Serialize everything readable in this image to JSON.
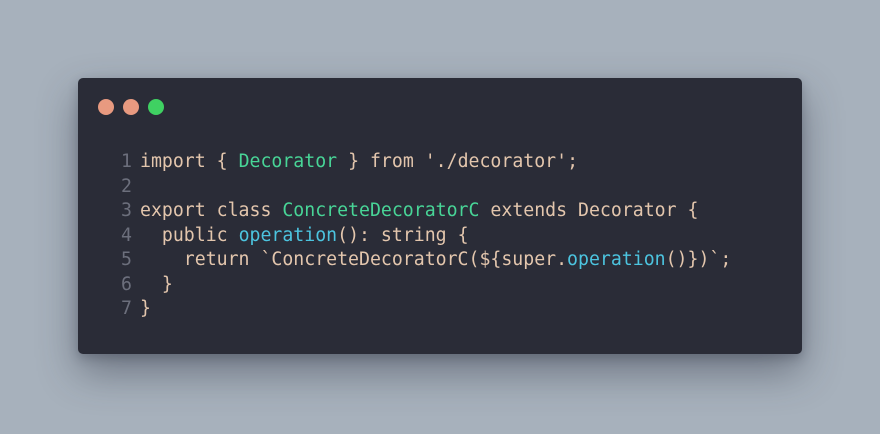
{
  "window": {
    "controls": [
      {
        "name": "close",
        "color": "#e89a80"
      },
      {
        "name": "minimize",
        "color": "#e89a80"
      },
      {
        "name": "maximize",
        "color": "#3fd162"
      }
    ]
  },
  "colors": {
    "background": "#a7b1bc",
    "editor": "#2a2c37",
    "keyword": "#e3c6ad",
    "type": "#48d597",
    "function": "#4cc4df",
    "line_number": "#6c6f7c"
  },
  "code": {
    "lines": [
      {
        "number": "1",
        "tokens": [
          {
            "t": "import { ",
            "k": "kw"
          },
          {
            "t": "Decorator",
            "k": "type"
          },
          {
            "t": " } from './decorator';",
            "k": "kw"
          }
        ]
      },
      {
        "number": "2",
        "tokens": []
      },
      {
        "number": "3",
        "tokens": [
          {
            "t": "export class ",
            "k": "kw"
          },
          {
            "t": "ConcreteDecoratorC",
            "k": "type"
          },
          {
            "t": " extends Decorator {",
            "k": "kw"
          }
        ]
      },
      {
        "number": "4",
        "tokens": [
          {
            "t": "  public ",
            "k": "kw"
          },
          {
            "t": "operation",
            "k": "fn"
          },
          {
            "t": "(): string {",
            "k": "kw"
          }
        ]
      },
      {
        "number": "5",
        "tokens": [
          {
            "t": "    return `ConcreteDecoratorC(${super.",
            "k": "kw"
          },
          {
            "t": "operation",
            "k": "fn"
          },
          {
            "t": "()})`;",
            "k": "kw"
          }
        ]
      },
      {
        "number": "6",
        "tokens": [
          {
            "t": "  }",
            "k": "kw"
          }
        ]
      },
      {
        "number": "7",
        "tokens": [
          {
            "t": "}",
            "k": "kw"
          }
        ]
      }
    ]
  }
}
